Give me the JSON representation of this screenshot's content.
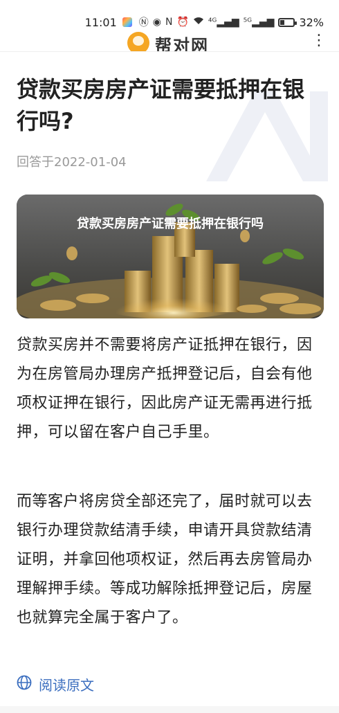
{
  "status_bar": {
    "time": "11:01",
    "network_1": "⁴ᴳ",
    "network_2": "⁵ᴳ",
    "battery": "32%",
    "battery_level": 0.32
  },
  "app_bar": {
    "logo_text": "帮对网"
  },
  "article": {
    "title": "贷款买房房产证需要抵押在银行吗?",
    "meta": "回答于2022-01-04",
    "banner_caption": "贷款买房房产证需要抵押在银行吗",
    "paragraphs": [
      "贷款买房并不需要将房产证抵押在银行，因为在房管局办理房产抵押登记后，自会有他项权证押在银行，因此房产证无需再进行抵押，可以留在客户自己手里。",
      "而等客户将房贷全部还完了，届时就可以去银行办理贷款结清手续，申请开具贷款结清证明，并拿回他项权证，然后再去房管局办理解押手续。等成功解除抵押登记后，房屋也就算完全属于客户了。"
    ],
    "read_original": "阅读原文"
  },
  "colors": {
    "link": "#3b6ebf",
    "meta": "#999999",
    "logo": "#f5a623"
  }
}
